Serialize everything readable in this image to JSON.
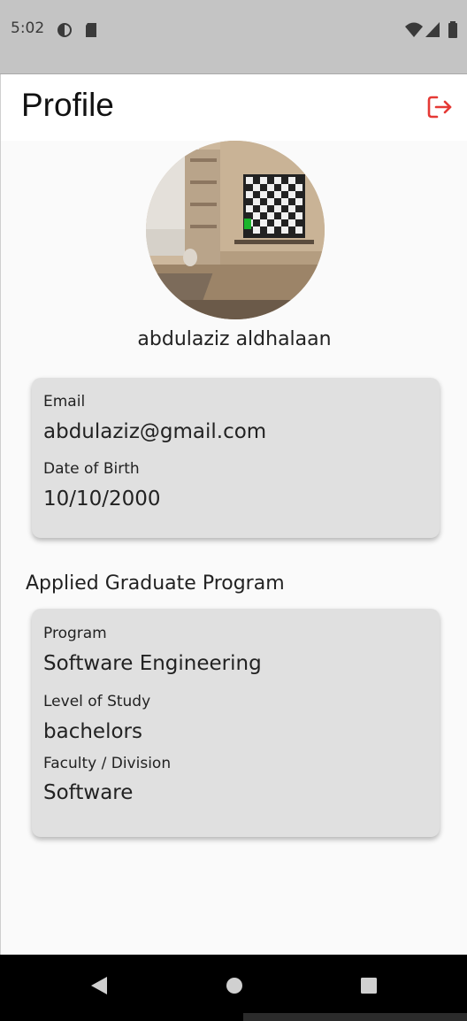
{
  "status_bar": {
    "time": "5:02",
    "left_icons": [
      "vpn-icon",
      "sd-card-icon"
    ],
    "right_icons": [
      "wifi-icon",
      "signal-icon",
      "battery-icon"
    ]
  },
  "app_bar": {
    "title": "Profile",
    "action_icon": "logout-icon",
    "accent_color": "#e53935"
  },
  "profile": {
    "name": "abdulaziz aldhalaan",
    "avatar_icon": "profile-photo"
  },
  "personal_card": {
    "email_label": "Email",
    "email_value": "abdulaziz@gmail.com",
    "dob_label": "Date of Birth",
    "dob_value": "10/10/2000"
  },
  "program_section": {
    "title": "Applied Graduate Program",
    "program_label": "Program",
    "program_value": "Software Engineering",
    "level_label": "Level of Study",
    "level_value": "bachelors",
    "faculty_label": "Faculty / Division",
    "faculty_value": "Software"
  },
  "nav_bar": {
    "buttons": [
      "back-icon",
      "home-icon",
      "recents-icon"
    ]
  }
}
